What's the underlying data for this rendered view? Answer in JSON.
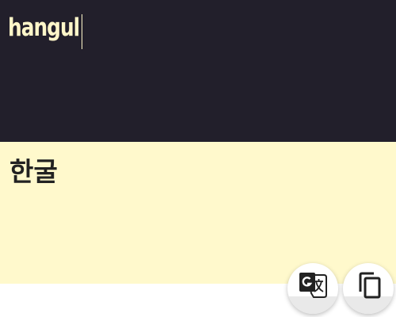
{
  "input": {
    "text": "hangul"
  },
  "output": {
    "text": "한굴"
  },
  "actions": {
    "translate_icon": "google-translate-icon",
    "copy_icon": "copy-icon"
  },
  "colors": {
    "input_bg": "#221f2b",
    "input_text": "#fff6c9",
    "output_bg": "#fff9cc",
    "output_text": "#222222"
  }
}
